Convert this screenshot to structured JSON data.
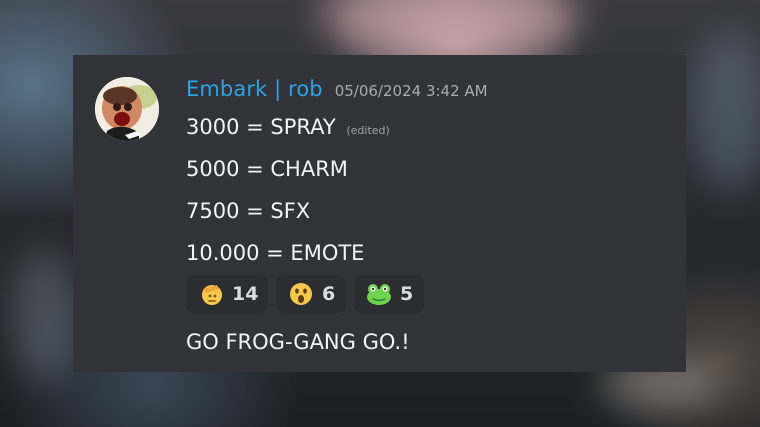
{
  "message": {
    "author": "Embark | rob",
    "timestamp": "05/06/2024 3:42 AM",
    "lines": [
      "3000 = SPRAY",
      "5000 = CHARM",
      "7500 = SFX",
      "10.000 = EMOTE"
    ],
    "edited_label": "(edited)",
    "footer_text": "GO FROG-GANG GO.!"
  },
  "reactions": [
    {
      "icon": "saluting-face-icon",
      "count": "14"
    },
    {
      "icon": "surprised-face-icon",
      "count": "6"
    },
    {
      "icon": "frog-face-icon",
      "count": "5"
    }
  ],
  "colors": {
    "card_background": "#313338",
    "reaction_background": "#2b2d31",
    "username": "#2fa3e4",
    "text": "#f2f3f5",
    "muted": "#a8abb2"
  }
}
